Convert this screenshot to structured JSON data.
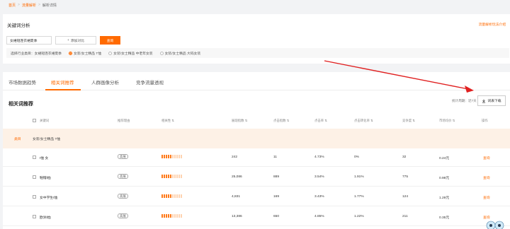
{
  "breadcrumb": {
    "home": "首页",
    "parent": "流量解析",
    "current": "解析详情"
  },
  "keyword_section": {
    "title": "关键词分析",
    "help_link": "流量解析玩法介绍",
    "input_value": "女裙短连衣裙夏季",
    "add_compare": "添加对比",
    "query": "查询",
    "industry_label": "选择行业类目：",
    "industry_selected_name": "女裙短连衣裙夏季",
    "industry_options": [
      "女装/女士精品 T恤",
      "女装/女士精品 中老年女装",
      "女装/女士精品 大码女装"
    ],
    "industry_checked_index": 0
  },
  "tabs": [
    "市场数据趋势",
    "相关词推荐",
    "人群画像分析",
    "竞争流量透视"
  ],
  "active_tab": 1,
  "section_title": "相关词推荐",
  "period": "统计周期：近7天",
  "download_label": "词表下载",
  "columns": [
    "关键词",
    "推荐理由",
    "相关性 ⇅",
    "展现指数 ⇅",
    "点击指数 ⇅",
    "点击率 ⇅",
    "点击转化率 ⇅",
    "竞争度 ⇅",
    "市场均价 ⇅",
    "操作"
  ],
  "group": {
    "badge": "类目",
    "name": "女装/女士精品 T恤"
  },
  "rows": [
    {
      "keyword": "t恤 女",
      "reason": "高展",
      "relevance": 0.5,
      "impressions": "242",
      "clicks": "11",
      "ctr": "4.73%",
      "cvr": "0%",
      "competition": "32",
      "price": "0.24元",
      "action": "查询"
    },
    {
      "keyword": "鞋帽t恤",
      "reason": "高展",
      "relevance": 0.5,
      "impressions": "25,086",
      "clicks": "889",
      "ctr": "3.54%",
      "cvr": "1.91%",
      "competition": "775",
      "price": "0.98元",
      "action": "查询"
    },
    {
      "keyword": "女中学生t恤",
      "reason": "高展",
      "relevance": 0.5,
      "impressions": "4,831",
      "clicks": "169",
      "ctr": "3.43%",
      "cvr": "1.77%",
      "competition": "124",
      "price": "1.29元",
      "action": "查询"
    },
    {
      "keyword": "欧洲t恤",
      "reason": "高展",
      "relevance": 0.5,
      "impressions": "13,386",
      "clicks": "650",
      "ctr": "4.85%",
      "cvr": "1.22%",
      "competition": "211",
      "price": "0.35元",
      "action": "查询"
    }
  ],
  "colors": {
    "accent": "#ff6a00",
    "group_bg": "#fdf1e6",
    "arrow": "#e02020"
  }
}
